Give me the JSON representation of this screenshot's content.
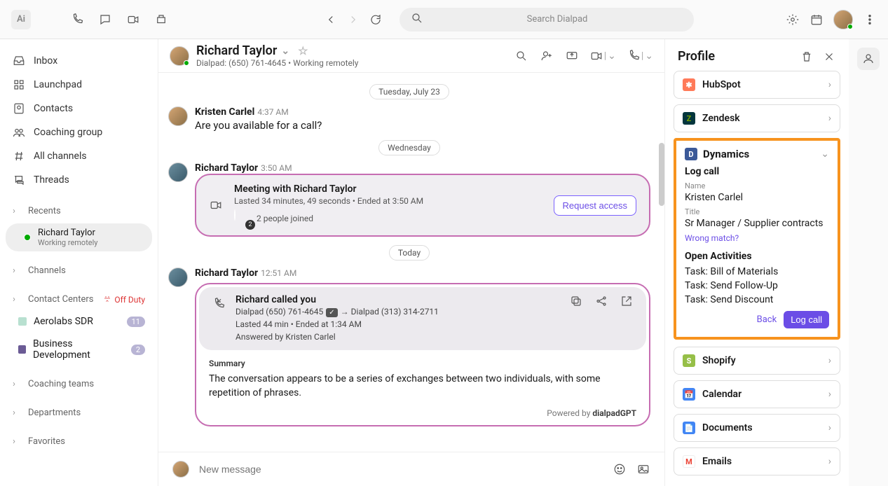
{
  "topbar": {
    "search_placeholder": "Search Dialpad"
  },
  "sidebar": {
    "items": [
      {
        "label": "Inbox"
      },
      {
        "label": "Launchpad"
      },
      {
        "label": "Contacts"
      },
      {
        "label": "Coaching group"
      },
      {
        "label": "All channels"
      },
      {
        "label": "Threads"
      }
    ],
    "recents_label": "Recents",
    "contact": {
      "name": "Richard Taylor",
      "status": "Working remotely"
    },
    "channels_label": "Channels",
    "contact_centers_label": "Contact Centers",
    "off_duty": "Off Duty",
    "aerolabs": {
      "label": "Aerolabs SDR",
      "badge": "11"
    },
    "bizdev": {
      "label": "Business Development",
      "badge": "2"
    },
    "coaching_teams": "Coaching teams",
    "departments": "Departments",
    "favorites": "Favorites"
  },
  "chat": {
    "header": {
      "name": "Richard Taylor",
      "sub": "Dialpad: (650) 761-4645 • Working remotely"
    },
    "date1": "Tuesday, July 23",
    "msg1": {
      "name": "Kristen Carlel",
      "time": "4:37 AM",
      "text": "Are you available for a call?"
    },
    "date2": "Wednesday",
    "msg2": {
      "name": "Richard Taylor",
      "time": "3:50 AM"
    },
    "meeting": {
      "title": "Meeting with Richard Taylor",
      "sub": "Lasted 34 minutes, 49 seconds • Ended at 3:50 AM",
      "joined": "2 people joined",
      "button": "Request access"
    },
    "date3": "Today",
    "msg3": {
      "name": "Richard Taylor",
      "time": "12:51 AM"
    },
    "call": {
      "title": "Richard called you",
      "line1a": "Dialpad (650) 761-4645",
      "line1b": "Dialpad (313) 314-2711",
      "line2": "Lasted 44 min • Ended at 1:34 AM",
      "line3": "Answered by Kristen Carlel",
      "summary_label": "Summary",
      "summary_text": "The conversation appears to be a series of exchanges between two individuals, with some repetition of phrases.",
      "powered_prefix": "Powered by ",
      "powered_brand": "dialpadGPT"
    },
    "composer_placeholder": "New message"
  },
  "profile": {
    "title": "Profile",
    "hubspot": "HubSpot",
    "zendesk": "Zendesk",
    "dynamics": {
      "title": "Dynamics",
      "log_call": "Log call",
      "name_label": "Name",
      "name": "Kristen Carlel",
      "title_label": "Title",
      "title_val": "Sr Manager / Supplier contracts",
      "wrong": "Wrong match?",
      "open_act": "Open Activities",
      "tasks": [
        "Task: Bill of Materials",
        "Task: Send Follow-Up",
        "Task: Send Discount"
      ],
      "back": "Back",
      "log_btn": "Log call"
    },
    "shopify": "Shopify",
    "calendar": "Calendar",
    "documents": "Documents",
    "emails": "Emails"
  }
}
